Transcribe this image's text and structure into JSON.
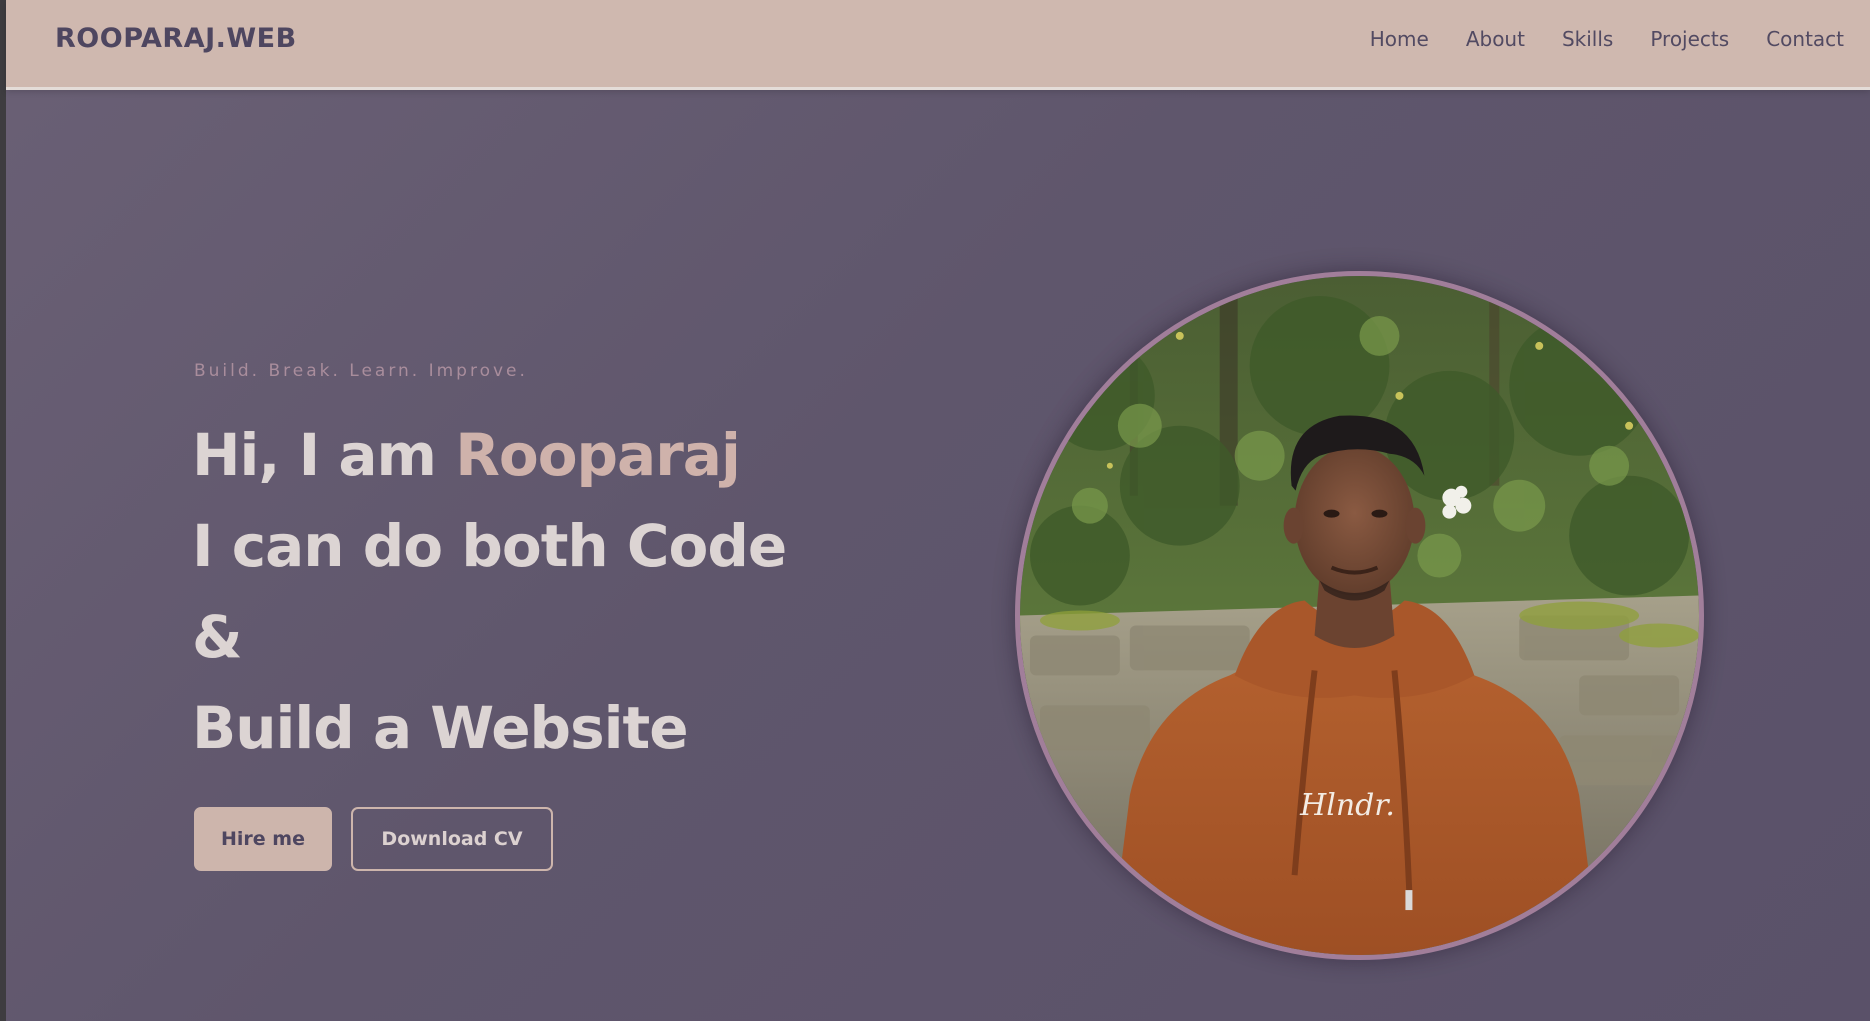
{
  "header": {
    "brand": "ROOPARAJ.WEB",
    "nav": [
      "Home",
      "About",
      "Skills",
      "Projects",
      "Contact"
    ]
  },
  "hero": {
    "tagline": "Build. Break. Learn. Improve.",
    "greeting": "Hi, I am ",
    "name": "Rooparaj",
    "line2": "I can do both Code",
    "line3": "&",
    "line4": "Build a Website",
    "hire_button": "Hire me",
    "cv_button": "Download CV",
    "hoodie_logo": "Hlndr."
  },
  "colors": {
    "navbar": "#cfb8af",
    "background": "#5f566b",
    "accent": "#cfb2ab",
    "heading": "#dcd4d3",
    "portrait_border": "#a17e9a"
  }
}
